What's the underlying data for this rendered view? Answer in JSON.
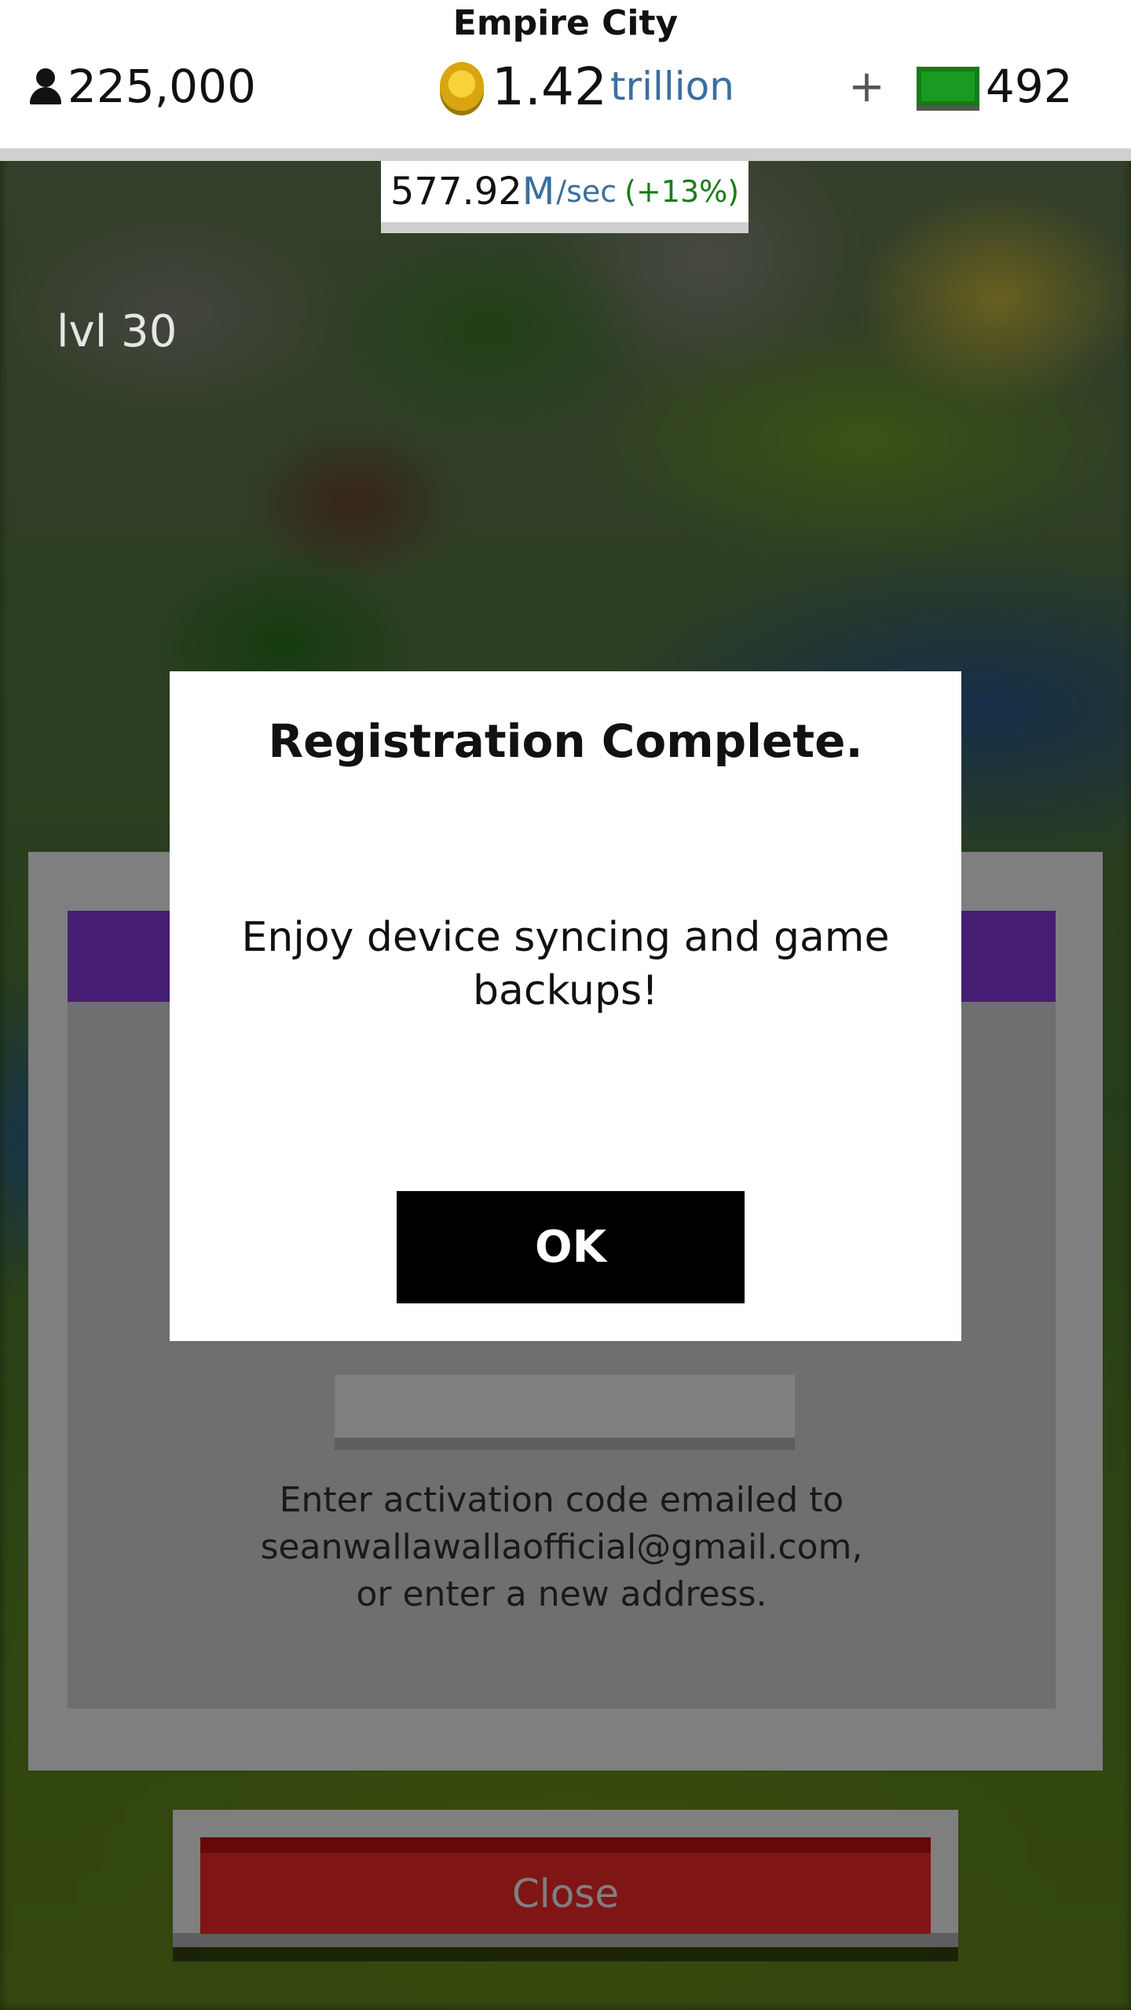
{
  "header": {
    "city_name": "Empire City",
    "population": "225,000",
    "coins_value": "1.42",
    "coins_unit": "trillion",
    "plus_label": "+",
    "cash_value": "492"
  },
  "income": {
    "value": "577.92",
    "unit": "M",
    "per": "/sec",
    "bonus": "(+13%)"
  },
  "level": "lvl 30",
  "panel": {
    "hint_lines": [
      "Enter activation code emailed to",
      "seanwallawallaofficial@gmail.com,",
      "or enter a new address."
    ],
    "close_label": "Close"
  },
  "modal": {
    "title": "Registration Complete.",
    "message_lines": [
      "Enjoy device syncing and game",
      "backups!"
    ],
    "ok_label": "OK"
  },
  "colors": {
    "accent_purple": "#8a3ce8",
    "close_red": "#ff2a2a",
    "income_blue": "#3b6f9e",
    "bonus_green": "#1b7a1b",
    "cash_green": "#1b9a21"
  },
  "icons": [
    "person-icon",
    "coin-icon",
    "cash-bill-icon"
  ]
}
